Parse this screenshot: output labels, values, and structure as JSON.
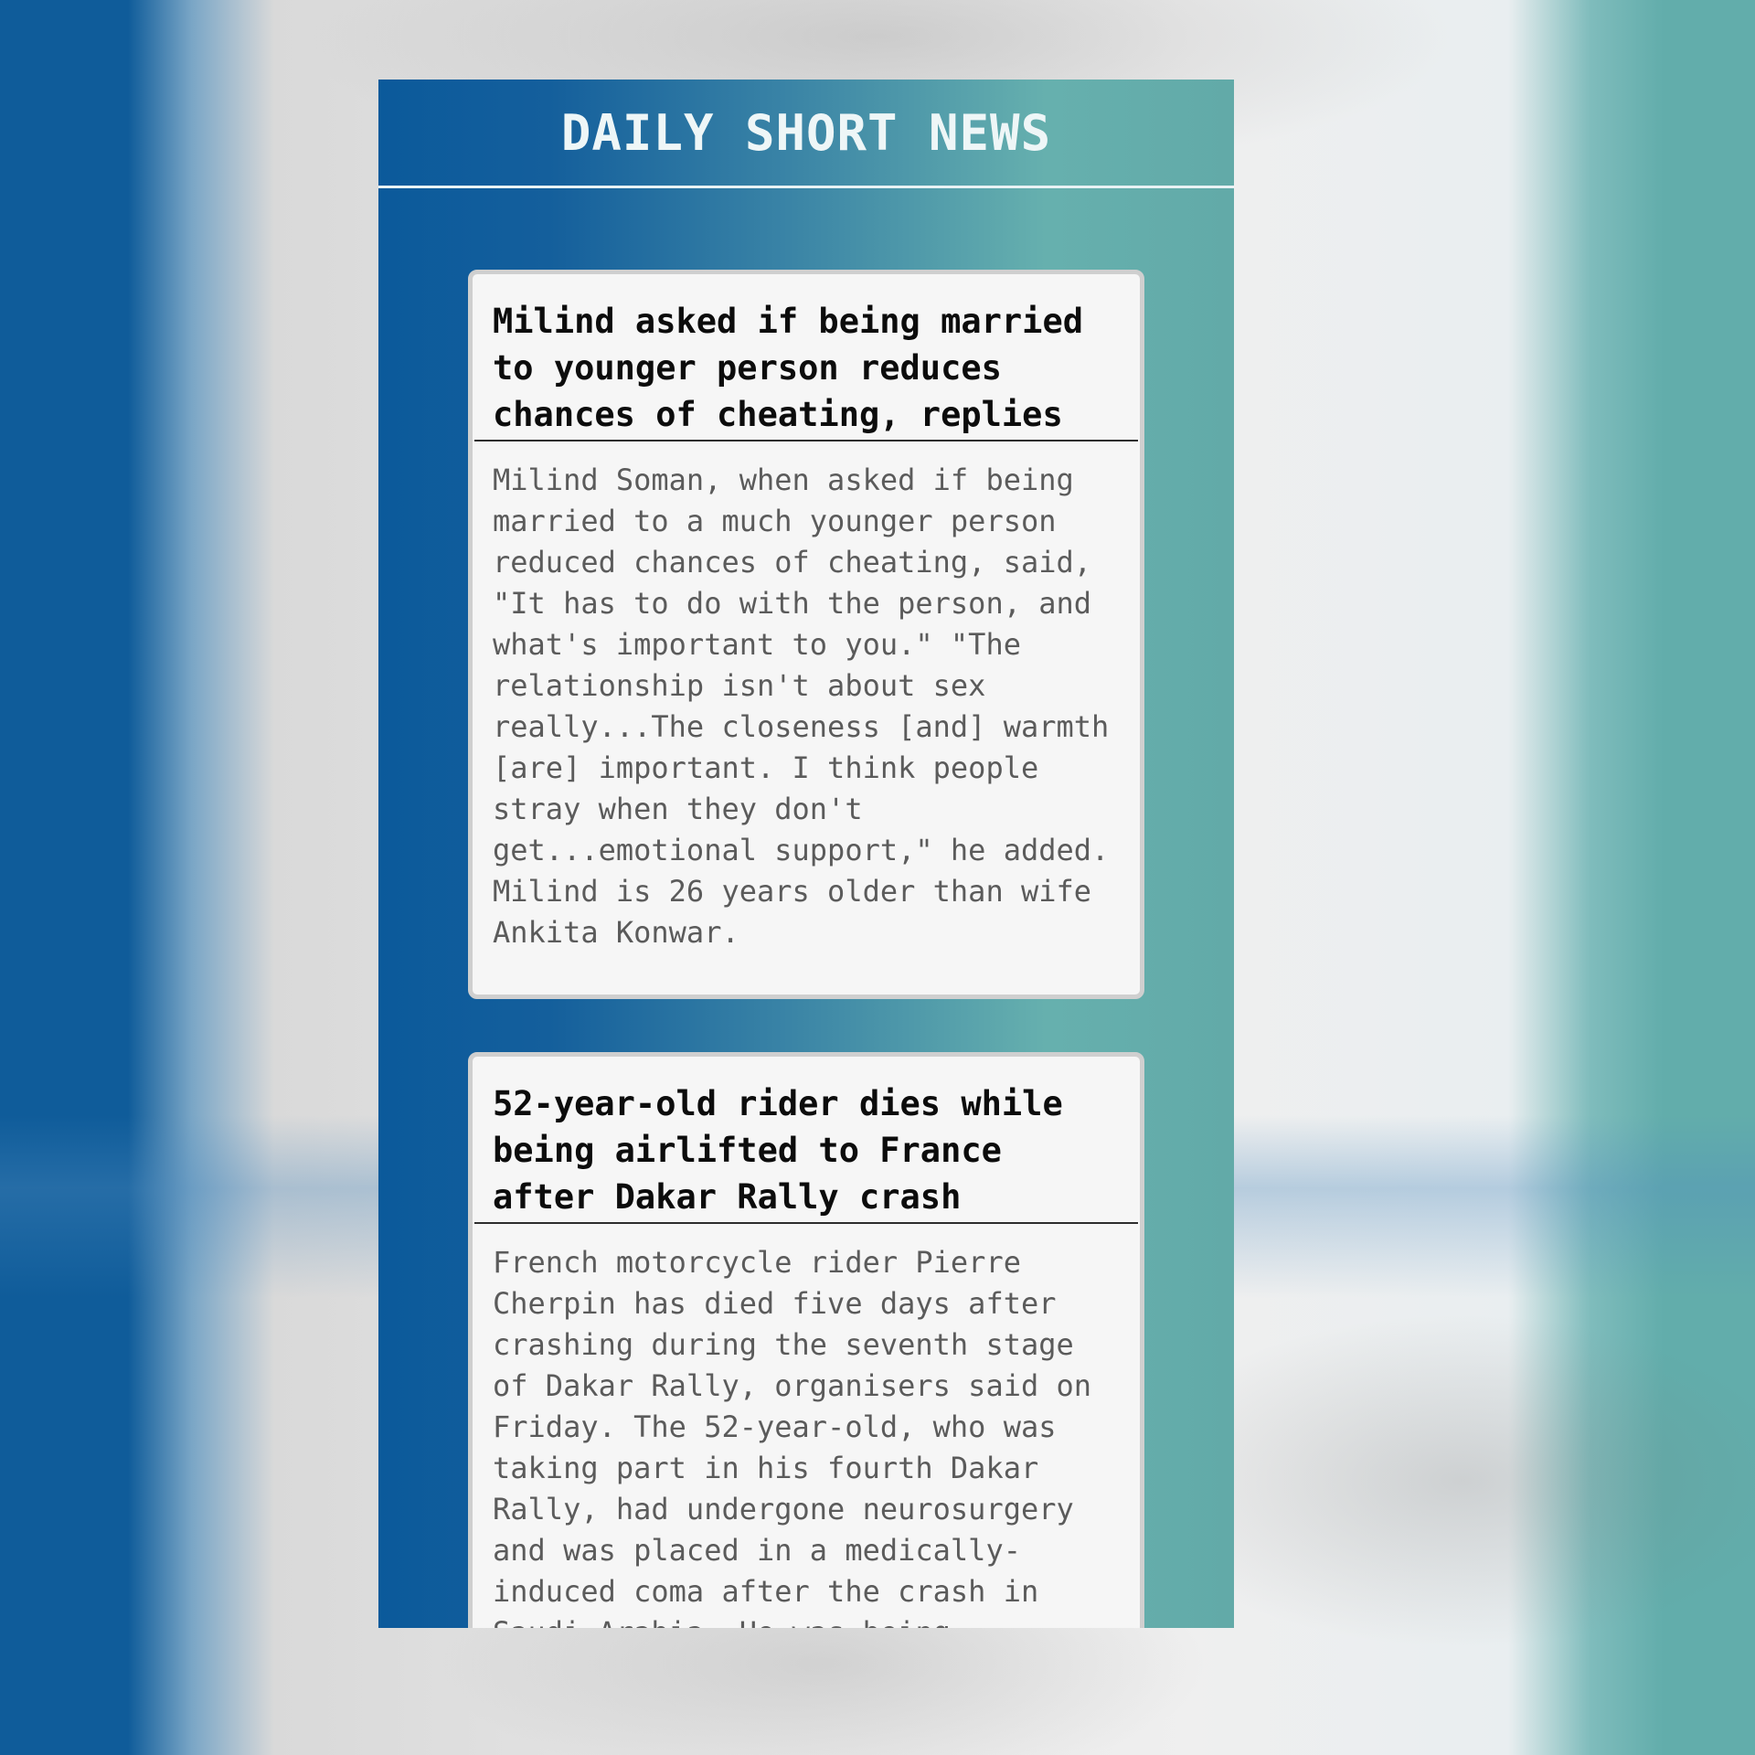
{
  "app": {
    "title": "DAILY SHORT NEWS"
  },
  "articles": [
    {
      "title": "Milind asked if being married to younger person reduces chances of cheating, replies",
      "body": "Milind Soman, when asked if being married to a much younger person reduced chances of cheating, said, \"It has to do with the person, and what's important to you.\" \"The relationship isn't about sex really...The closeness [and] warmth [are] important. I think people stray when they don't get...emotional support,\" he added. Milind is 26 years older than wife Ankita Konwar."
    },
    {
      "title": "52-year-old rider dies while being airlifted to France after Dakar Rally crash",
      "body": "French motorcycle rider Pierre Cherpin has died five days after crashing during the seventh stage of Dakar Rally, organisers said on Friday. The 52-year-old, who was taking part in his fourth Dakar Rally, had undergone neurosurgery and was placed in a medically-induced coma after the crash in Saudi Arabia. He was being"
    }
  ],
  "colors": {
    "header_gradient_start": "#0b5a9b",
    "header_gradient_end": "#62aaa8",
    "card_background": "#f6f6f6",
    "title_text": "#0c0c0c",
    "body_text": "#5b5b5b"
  }
}
